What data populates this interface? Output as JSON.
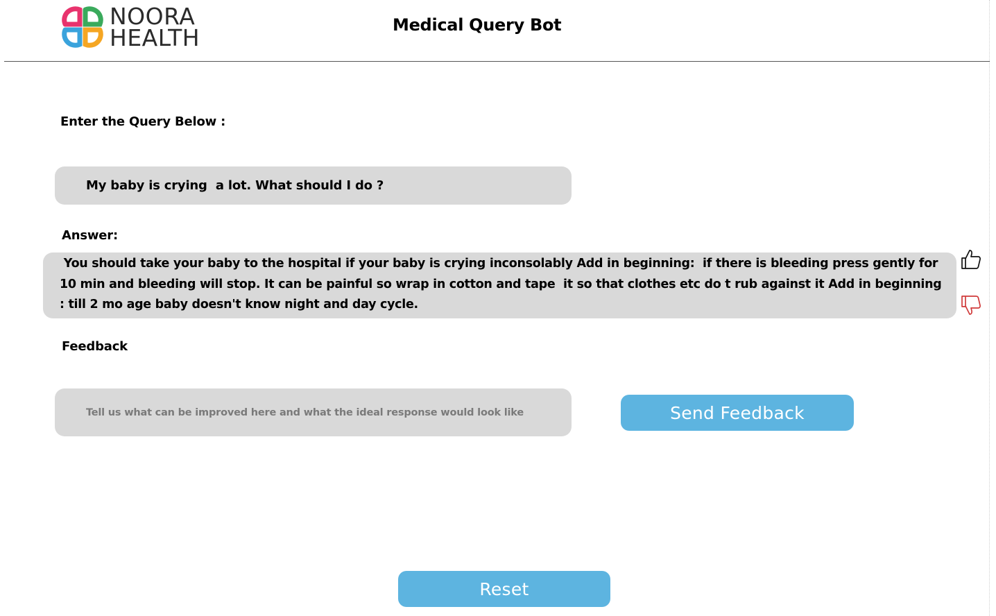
{
  "header": {
    "logo": {
      "line1": "NOORA",
      "line2": "HEALTH",
      "colors": [
        "#e8336d",
        "#3aaa5c",
        "#3aa3dc",
        "#f5a623"
      ]
    },
    "title": "Medical Query Bot"
  },
  "query": {
    "label": "Enter the Query Below :",
    "value": "My baby is crying  a lot. What should I do ?"
  },
  "answer": {
    "label": "Answer:",
    "text": " You should take your baby to the hospital if your baby is crying inconsolably Add in beginning:  if there is bleeding press gently for 10 min and bleeding will stop. It can be painful so wrap in cotton and tape  it so that clothes etc do t rub against it Add in beginning : till 2 mo age baby doesn't know night and day cycle."
  },
  "rating": {
    "up_icon": "thumbs-up-icon",
    "down_icon": "thumbs-down-icon",
    "down_color": "#d03a3a"
  },
  "feedback": {
    "label": "Feedback",
    "placeholder": "Tell us what can be improved here and what the ideal response would look like",
    "value": "",
    "send_label": "Send Feedback"
  },
  "reset_label": "Reset",
  "colors": {
    "button": "#5db4e0",
    "field": "#d9d9d9"
  }
}
